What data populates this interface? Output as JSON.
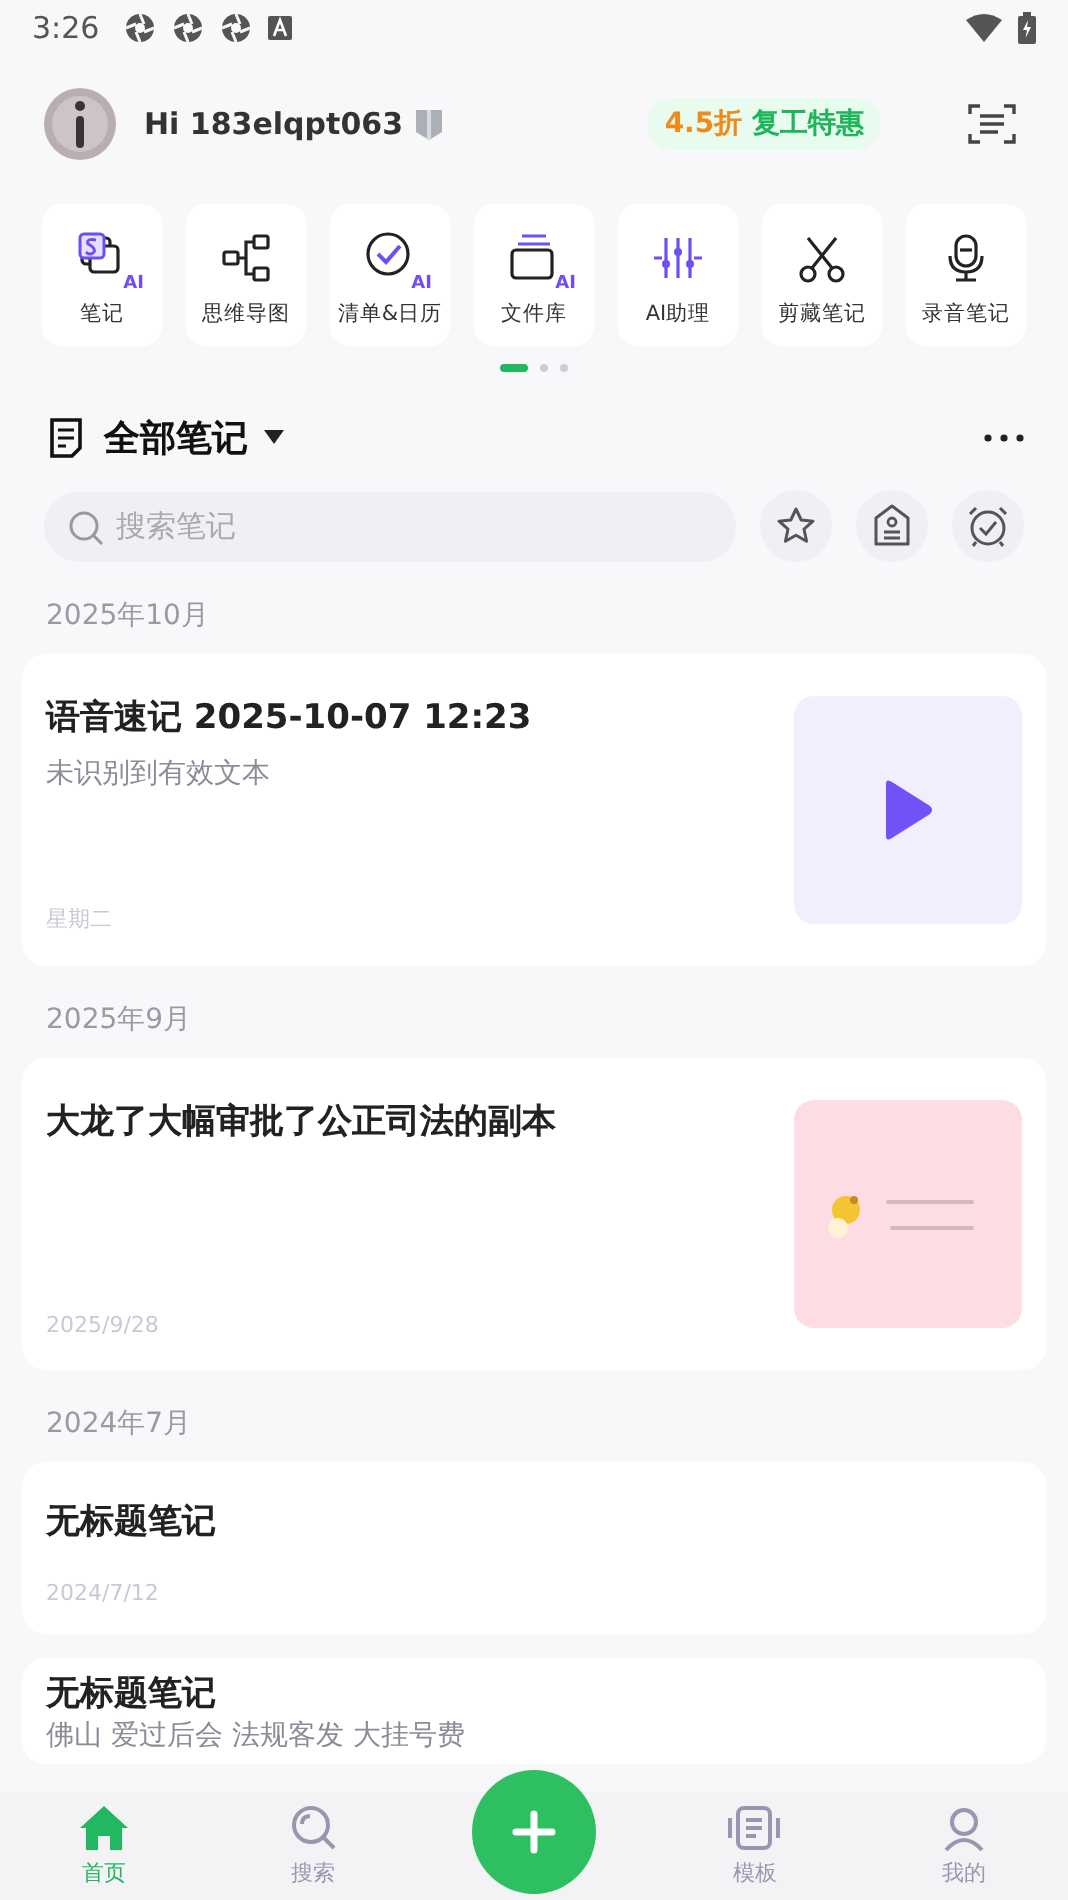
{
  "status_bar": {
    "time": "3:26"
  },
  "header": {
    "greeting": "Hi 183elqpt063",
    "promo": {
      "discount": "4.5折",
      "label": "复工特惠"
    }
  },
  "tools": [
    {
      "kind": "note",
      "label": "笔记",
      "badge": "AI"
    },
    {
      "kind": "mindmap",
      "label": "思维导图"
    },
    {
      "kind": "checklist",
      "label": "清单&日历",
      "badge": "AI"
    },
    {
      "kind": "files",
      "label": "文件库",
      "badge": "AI"
    },
    {
      "kind": "assistant",
      "label": "AI助理"
    },
    {
      "kind": "clip",
      "label": "剪藏笔记"
    },
    {
      "kind": "recorder",
      "label": "录音笔记"
    }
  ],
  "pager": [
    {
      "selected": true
    },
    {
      "selected": false
    },
    {
      "selected": false
    }
  ],
  "notes_header": {
    "title": "全部笔记"
  },
  "search": {
    "placeholder": "搜索笔记"
  },
  "sections": [
    {
      "month": "2025年10月",
      "notes": [
        {
          "title": "语音速记 2025-10-07 12:23",
          "preview": "未识别到有效文本",
          "date": "星期二",
          "kind": "audio"
        }
      ]
    },
    {
      "month": "2025年9月",
      "notes": [
        {
          "title": "大龙了大幅审批了公正司法的副本",
          "date": "2025/9/28",
          "kind": "picture"
        }
      ]
    },
    {
      "month": "2024年7月",
      "notes": [
        {
          "title": "无标题笔记",
          "date": "2024/7/12"
        },
        {
          "title": "无标题笔记",
          "preview": "佛山 爱过后会 法规客发 大挂号费"
        }
      ]
    }
  ],
  "nav": [
    {
      "kind": "home",
      "label": "首页",
      "selected": true
    },
    {
      "kind": "search",
      "label": "搜索",
      "selected": false
    },
    {
      "kind": "add"
    },
    {
      "kind": "template",
      "label": "模板",
      "selected": false
    },
    {
      "kind": "me",
      "label": "我的",
      "selected": false
    }
  ]
}
